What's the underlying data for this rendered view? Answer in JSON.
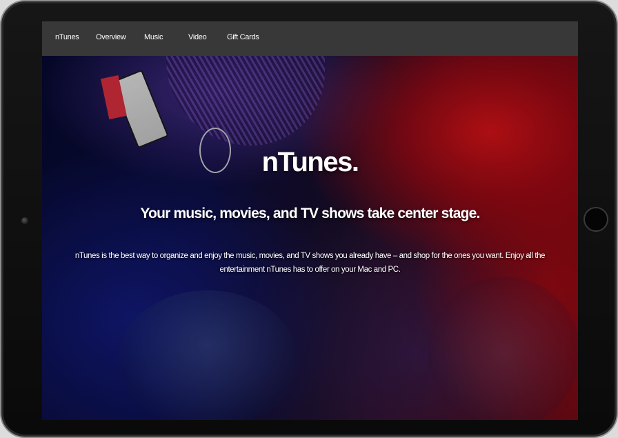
{
  "nav": {
    "items": [
      {
        "label": "nTunes"
      },
      {
        "label": "Overview"
      },
      {
        "label": "Music"
      },
      {
        "label": "Video"
      },
      {
        "label": "Gift Cards"
      }
    ]
  },
  "hero": {
    "title": "nTunes.",
    "subtitle": "Your music, movies, and TV shows take center stage.",
    "body": "nTunes is the best way to organize and enjoy the music, movies, and TV shows you already have – and shop for the ones you want. Enjoy all the entertainment nTunes has to offer on your Mac and PC."
  },
  "colors": {
    "navbar": "#383838",
    "bezel": "#111111",
    "accent_red": "#e01419",
    "accent_blue": "#141e8c"
  }
}
